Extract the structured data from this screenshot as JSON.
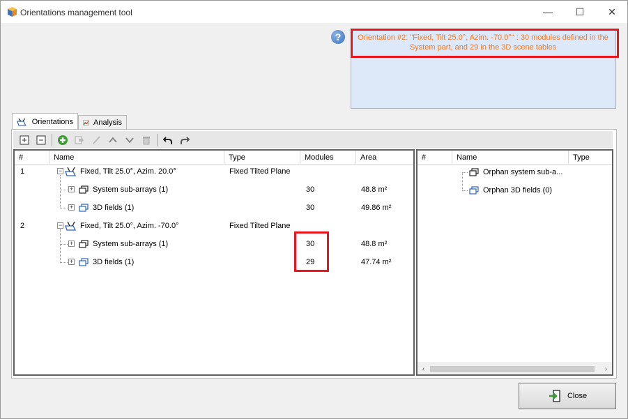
{
  "window": {
    "title": "Orientations management tool",
    "controls": {
      "minimize": "—",
      "maximize": "☐",
      "close": "✕"
    }
  },
  "info": {
    "text": "Orientation #2: \"Fixed, Tilt 25.0°, Azim. -70.0°\" : 30 modules defined in the System part, and 29 in the 3D scene tables"
  },
  "tabs": [
    {
      "label": "Orientations",
      "icon": "orientation-icon",
      "active": true
    },
    {
      "label": "Analysis",
      "icon": "chart-icon",
      "active": false
    }
  ],
  "toolbar": {
    "buttons": [
      "expand-all-icon",
      "collapse-all-icon",
      "add-icon",
      "move-icon",
      "edit-icon",
      "up-icon",
      "down-icon",
      "delete-icon",
      "undo-icon",
      "redo-icon"
    ]
  },
  "main_table": {
    "columns": [
      "#",
      "Name",
      "Type",
      "Modules",
      "Area"
    ],
    "rows": [
      {
        "num": "1",
        "name": "Fixed, Tilt 25.0°, Azim. 20.0°",
        "type": "Fixed Tilted Plane",
        "modules": "",
        "area": ""
      },
      {
        "num": "",
        "name": "System sub-arrays (1)",
        "type": "",
        "modules": "30",
        "area": "48.8 m²"
      },
      {
        "num": "",
        "name": "3D fields (1)",
        "type": "",
        "modules": "30",
        "area": "49.86 m²"
      },
      {
        "num": "2",
        "name": "Fixed, Tilt 25.0°, Azim. -70.0°",
        "type": "Fixed Tilted Plane",
        "modules": "",
        "area": ""
      },
      {
        "num": "",
        "name": "System sub-arrays (1)",
        "type": "",
        "modules": "30",
        "area": "48.8 m²"
      },
      {
        "num": "",
        "name": "3D fields (1)",
        "type": "",
        "modules": "29",
        "area": "47.74 m²"
      }
    ]
  },
  "orphan_table": {
    "columns": [
      "#",
      "Name",
      "Type"
    ],
    "rows": [
      {
        "name": "Orphan system sub-a..."
      },
      {
        "name": "Orphan 3D fields (0)"
      }
    ]
  },
  "close_button": {
    "label": "Close"
  },
  "colors": {
    "highlight": "#e8151e",
    "info_text": "#f07820",
    "info_bg": "#dde8f8"
  }
}
